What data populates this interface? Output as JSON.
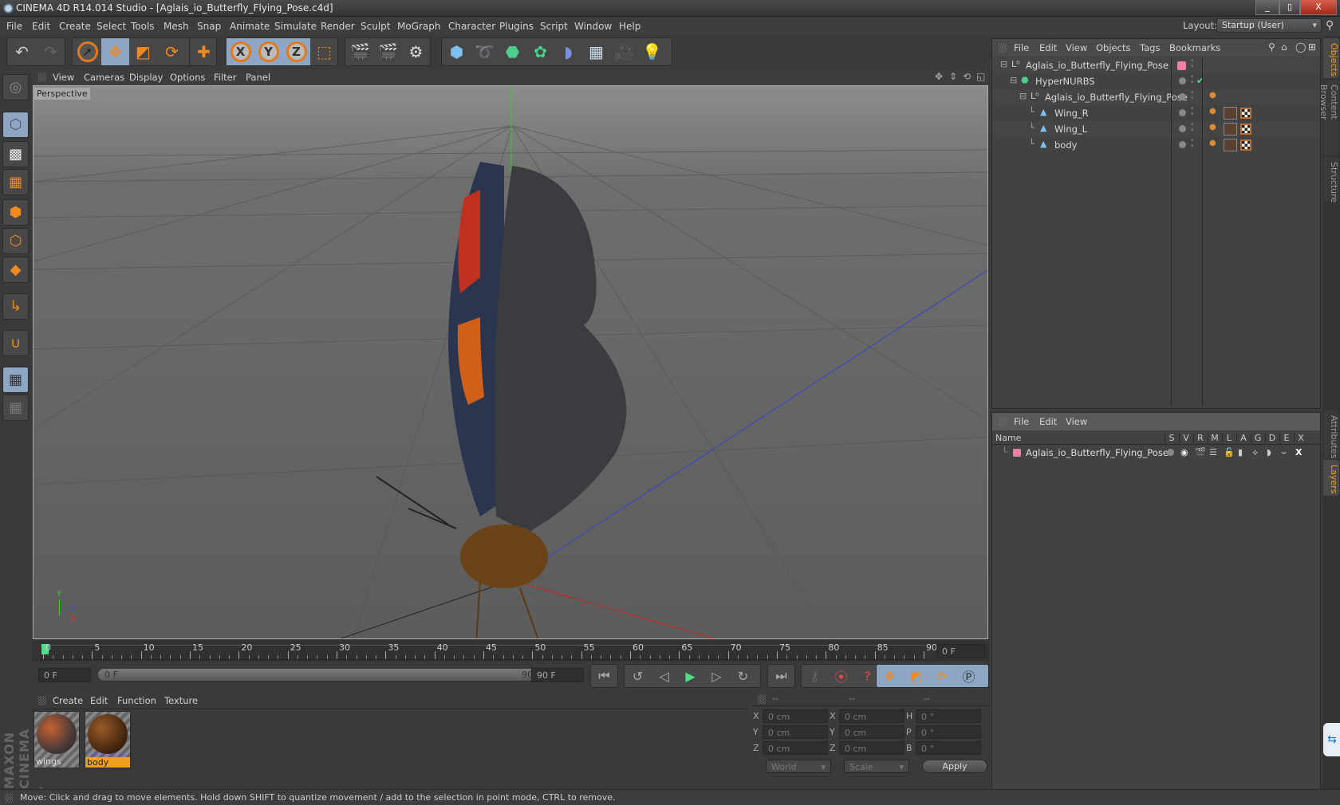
{
  "window": {
    "title": "CINEMA 4D R14.014 Studio - [Aglais_io_Butterfly_Flying_Pose.c4d]",
    "minimize": "_",
    "maximize": "▯",
    "close": "X"
  },
  "menubar": {
    "items": [
      "File",
      "Edit",
      "Create",
      "Select",
      "Tools",
      "Mesh",
      "Snap",
      "Animate",
      "Simulate",
      "Render",
      "Sculpt",
      "MoGraph",
      "Character",
      "Plugins",
      "Script",
      "Window",
      "Help"
    ],
    "layout_label": "Layout:",
    "layout_value": "Startup (User)"
  },
  "toolbar": {
    "tools": [
      "undo",
      "redo",
      "live-selection",
      "move",
      "scale",
      "rotate",
      "create-axis",
      "x-axis",
      "y-axis",
      "z-axis",
      "coordinate-system",
      "render-view",
      "render-picture-viewer",
      "edit-render-settings",
      "cube",
      "spline",
      "nurbs",
      "mograph-cloner",
      "deformer",
      "floor",
      "camera",
      "light"
    ],
    "axis_labels": [
      "X",
      "Y",
      "Z"
    ]
  },
  "viewport": {
    "menu": [
      "View",
      "Cameras",
      "Display",
      "Options",
      "Filter",
      "Panel"
    ],
    "label": "Perspective",
    "axis": {
      "y": "Y",
      "z": "Z",
      "x": "X"
    }
  },
  "timeline": {
    "ticks": [
      "0",
      "5",
      "10",
      "15",
      "20",
      "25",
      "30",
      "35",
      "40",
      "45",
      "50",
      "55",
      "60",
      "65",
      "70",
      "75",
      "80",
      "85",
      "90"
    ],
    "current_frame": "0 F",
    "start_frame": "0 F",
    "range_start": "0 F",
    "range_end": "90 F",
    "end_frame": "90 F"
  },
  "materials": {
    "menu": [
      "Create",
      "Edit",
      "Function",
      "Texture"
    ],
    "items": [
      {
        "name": "wings",
        "selected": false
      },
      {
        "name": "body",
        "selected": true
      }
    ]
  },
  "coordinates": {
    "headers": [
      "--",
      "--",
      "--"
    ],
    "rows": [
      {
        "pos_label": "X",
        "pos": "0 cm",
        "size_label": "X",
        "size": "0 cm",
        "rot_label": "H",
        "rot": "0 °"
      },
      {
        "pos_label": "Y",
        "pos": "0 cm",
        "size_label": "Y",
        "size": "0 cm",
        "rot_label": "P",
        "rot": "0 °"
      },
      {
        "pos_label": "Z",
        "pos": "0 cm",
        "size_label": "Z",
        "size": "0 cm",
        "rot_label": "B",
        "rot": "0 °"
      }
    ],
    "mode": "World",
    "transform": "Scale",
    "apply": "Apply"
  },
  "objects_panel": {
    "menu": [
      "File",
      "Edit",
      "View",
      "Objects",
      "Tags",
      "Bookmarks"
    ],
    "tree": [
      {
        "name": "Aglais_io_Butterfly_Flying_Pose",
        "type": "null",
        "level": 0
      },
      {
        "name": "HyperNURBS",
        "type": "hypernurbs",
        "level": 1
      },
      {
        "name": "Aglais_io_Butterfly_Flying_Pose",
        "type": "null",
        "level": 2
      },
      {
        "name": "Wing_R",
        "type": "polygon",
        "level": 3
      },
      {
        "name": "Wing_L",
        "type": "polygon",
        "level": 3
      },
      {
        "name": "body",
        "type": "polygon",
        "level": 3
      }
    ]
  },
  "layers_panel": {
    "menu": [
      "File",
      "Edit",
      "View"
    ],
    "columns": [
      "Name",
      "S",
      "V",
      "R",
      "M",
      "L",
      "A",
      "G",
      "D",
      "E",
      "X"
    ],
    "rows": [
      {
        "name": "Aglais_io_Butterfly_Flying_Pose",
        "color": "#f07fa8"
      }
    ]
  },
  "right_tabs": [
    "Objects",
    "Content Browser",
    "Structure",
    "Attributes",
    "Layers"
  ],
  "status": "Move: Click and drag to move elements. Hold down SHIFT to quantize movement / add to the selection in point mode, CTRL to remove.",
  "brand": "MAXON CINEMA 4D",
  "colors": {
    "accent": "#f08a20",
    "selected": "#8da6c4",
    "layer_pink": "#f07fa8",
    "frame_marker": "#4be08a"
  }
}
